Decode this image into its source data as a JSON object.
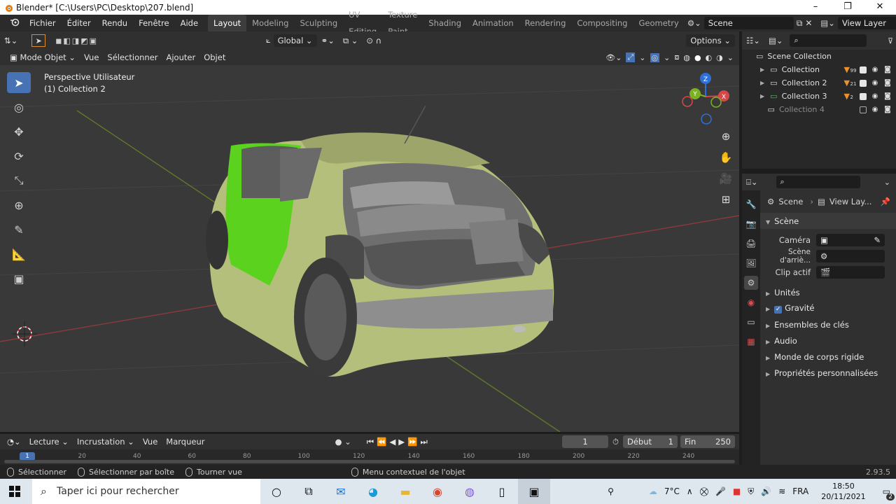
{
  "window": {
    "title": "Blender* [C:\\Users\\PC\\Desktop\\207.blend]",
    "controls": [
      "–",
      "❐",
      "✕"
    ]
  },
  "menu": [
    "Fichier",
    "Éditer",
    "Rendu",
    "Fenêtre",
    "Aide"
  ],
  "workspaces": {
    "active": "Layout",
    "items": [
      "Layout",
      "Modeling",
      "Sculpting",
      "UV Editing",
      "Texture Paint",
      "Shading",
      "Animation",
      "Rendering",
      "Compositing",
      "Geometry"
    ]
  },
  "scene_field": "Scene",
  "view_layer_field": "View Layer",
  "tool_header": {
    "orientation": "Global",
    "options": "Options"
  },
  "viewport_header": {
    "mode": "Mode Objet",
    "menus": [
      "Vue",
      "Sélectionner",
      "Ajouter",
      "Objet"
    ]
  },
  "viewport_info": {
    "line1": "Perspective Utilisateur",
    "line2": "(1) Collection 2"
  },
  "gizmo_axes": {
    "x": "X",
    "y": "Y",
    "z": "Z"
  },
  "outliner": {
    "root": "Scene Collection",
    "items": [
      {
        "label": "Collection",
        "count": "99",
        "visible": true
      },
      {
        "label": "Collection 2",
        "count": "21",
        "visible": true
      },
      {
        "label": "Collection 3",
        "count": "2",
        "visible": true
      },
      {
        "label": "Collection 4",
        "count": "",
        "visible": false
      }
    ]
  },
  "properties": {
    "breadcrumb_scene": "Scene",
    "breadcrumb_viewlayer": "View Lay...",
    "panel_title": "Scène",
    "camera_label": "Caméra",
    "background_label": "Scène d'arriè...",
    "clip_label": "Clip actif",
    "subpanels": [
      "Unités",
      "Gravité",
      "Ensembles de clés",
      "Audio",
      "Monde de corps rigide",
      "Propriétés personnalisées"
    ]
  },
  "timeline": {
    "menus": [
      "Lecture",
      "Incrustation",
      "Vue",
      "Marqueur"
    ],
    "current_frame": "1",
    "start_label": "Début",
    "start": "1",
    "end_label": "Fin",
    "end": "250",
    "ruler": [
      "1",
      "20",
      "40",
      "60",
      "80",
      "100",
      "120",
      "140",
      "160",
      "180",
      "200",
      "220",
      "240"
    ]
  },
  "statusbar": {
    "select": "Sélectionner",
    "box_select": "Sélectionner par boîte",
    "rotate": "Tourner vue",
    "context_menu": "Menu contextuel de l'objet",
    "version": "2.93.5"
  },
  "taskbar": {
    "search_placeholder": "Taper ici pour rechercher",
    "temperature": "7°C",
    "language": "FRA",
    "time": "18:50",
    "date": "20/11/2021",
    "notification_count": "2"
  },
  "colors": {
    "accent": "#4772b3",
    "car_body": "#b3bf7a",
    "car_door": "#5ad21e",
    "viewport_bg": "#393939"
  }
}
